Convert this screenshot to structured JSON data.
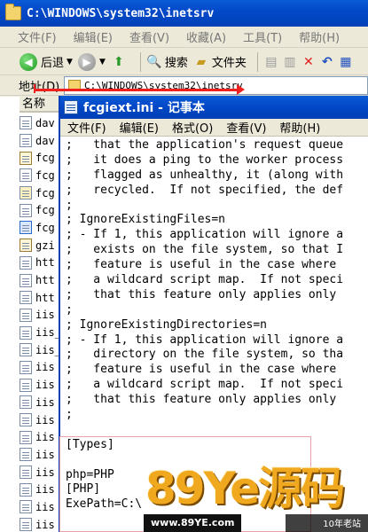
{
  "explorer": {
    "title": "C:\\WINDOWS\\system32\\inetsrv",
    "menu": [
      "文件(F)",
      "编辑(E)",
      "查看(V)",
      "收藏(A)",
      "工具(T)",
      "帮助(H)"
    ],
    "toolbar": {
      "back_label": "后退",
      "search_label": "搜索",
      "folders_label": "文件夹"
    },
    "address_label": "地址(D)",
    "address_value": "C:\\WINDOWS\\system32\\inetsrv",
    "column_name": "名称",
    "files": [
      "dav",
      "dav",
      "fcg",
      "fcg",
      "fcg",
      "fcg",
      "fcg",
      "gzi",
      "htt",
      "htt",
      "htt",
      "iis",
      "iis_",
      "iis_",
      "iis",
      "iis",
      "iis",
      "iis",
      "iis",
      "iis",
      "iis",
      "iis",
      "iis",
      "iis",
      "iis",
      "iis",
      "iis"
    ]
  },
  "notepad": {
    "title": "fcgiext.ini - 记事本",
    "menu": [
      "文件(F)",
      "编辑(E)",
      "格式(O)",
      "查看(V)",
      "帮助(H)"
    ],
    "lines": [
      ";   that the application's request queue",
      ";   it does a ping to the worker process",
      ";   flagged as unhealthy, it (along with",
      ";   recycled.  If not specified, the def",
      ";",
      "; IgnoreExistingFiles=n",
      "; - If 1, this application will ignore a",
      ";   exists on the file system, so that I",
      ";   feature is useful in the case where",
      ";   a wildcard script map.  If not speci",
      ";   that this feature only applies only",
      ";",
      "; IgnoreExistingDirectories=n",
      "; - If 1, this application will ignore a",
      ";   directory on the file system, so tha",
      ";   feature is useful in the case where",
      ";   a wildcard script map.  If not speci",
      ";   that this feature only applies only",
      ";",
      "",
      "[Types]",
      "",
      "php=PHP",
      "[PHP]",
      "ExePath=C:\\"
    ]
  },
  "watermark": {
    "brand": "89Ye源码",
    "url": "www.89YE.com",
    "tag": "10年老站"
  }
}
